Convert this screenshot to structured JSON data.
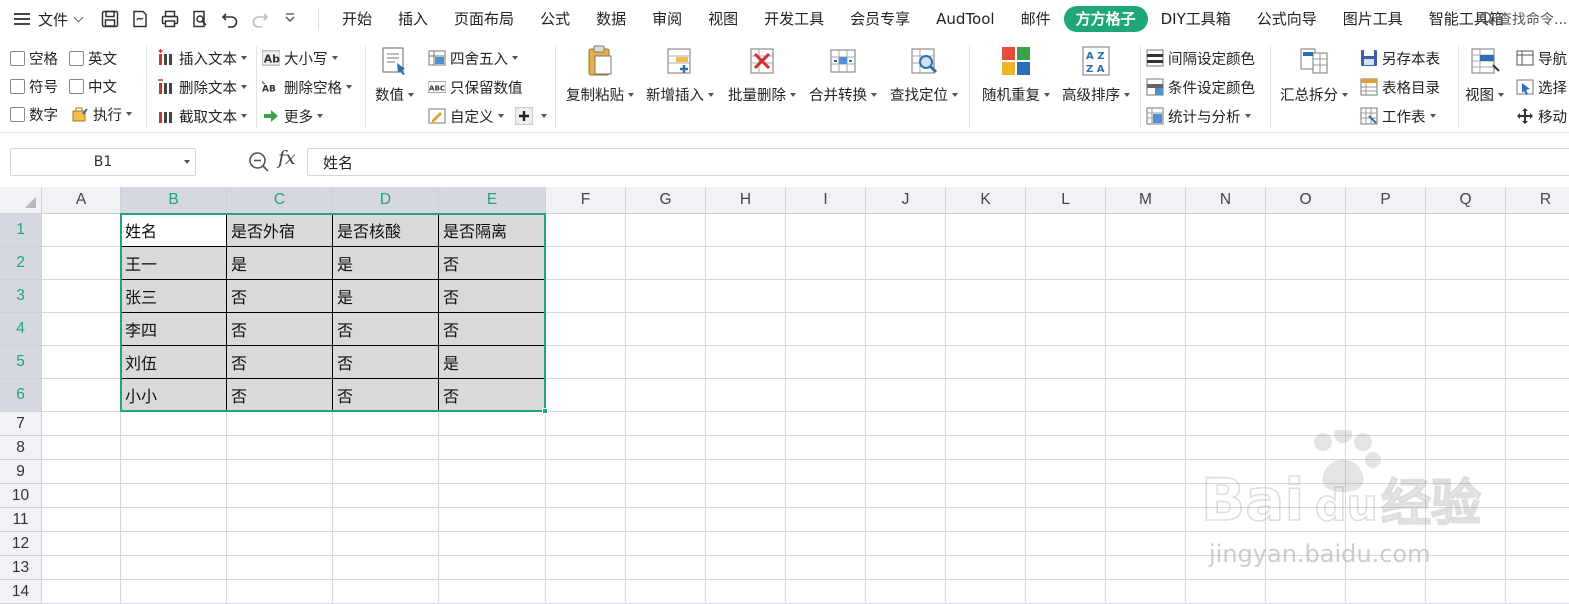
{
  "menubar": {
    "file_label": "文件",
    "tabs": [
      "开始",
      "插入",
      "页面布局",
      "公式",
      "数据",
      "审阅",
      "视图",
      "开发工具",
      "会员专享",
      "AudTool",
      "邮件",
      "方方格子",
      "DIY工具箱",
      "公式向导",
      "图片工具",
      "智能工具箱"
    ],
    "active_tab": "方方格子",
    "search_placeholder": "查找命令..."
  },
  "ribbon": {
    "checks": [
      "空格",
      "英文",
      "符号",
      "中文",
      "数字"
    ],
    "exec_label": "执行",
    "text_group": [
      "插入文本",
      "删除文本",
      "截取文本"
    ],
    "case_group": [
      "大小写",
      "删除空格",
      "更多"
    ],
    "value_label": "数值",
    "round_group": [
      "四舍五入",
      "只保留数值",
      "自定义"
    ],
    "big_buttons": [
      "复制粘贴",
      "新增插入",
      "批量删除",
      "合并转换",
      "查找定位",
      "随机重复",
      "高级排序"
    ],
    "color_group": [
      "间隔设定颜色",
      "条件设定颜色",
      "统计与分析"
    ],
    "summary_label": "汇总拆分",
    "sheet_group": [
      "另存本表",
      "表格目录",
      "工作表"
    ],
    "view_label": "视图",
    "nav_group": [
      "导航",
      "选择",
      "移动"
    ],
    "accent": "#1fa67a"
  },
  "formula_bar": {
    "name_box": "B1",
    "fx": "fx",
    "content": "姓名"
  },
  "sheet": {
    "columns": [
      "A",
      "B",
      "C",
      "D",
      "E",
      "F",
      "G",
      "H",
      "I",
      "J",
      "K",
      "L",
      "M",
      "N",
      "O",
      "P",
      "Q",
      "R"
    ],
    "rows": [
      "1",
      "2",
      "3",
      "4",
      "5",
      "6",
      "7",
      "8",
      "9",
      "10",
      "11",
      "12",
      "13",
      "14"
    ],
    "data": [
      [
        "姓名",
        "是否外宿",
        "是否核酸",
        "是否隔离"
      ],
      [
        "王一",
        "是",
        "是",
        "否"
      ],
      [
        "张三",
        "否",
        "是",
        "否"
      ],
      [
        "李四",
        "否",
        "否",
        "否"
      ],
      [
        "刘伍",
        "否",
        "否",
        "是"
      ],
      [
        "小小",
        "否",
        "否",
        "否"
      ]
    ]
  },
  "watermark": {
    "brand": "Bai",
    "du": "du",
    "cn": "经验",
    "url": "jingyan.baidu.com"
  }
}
